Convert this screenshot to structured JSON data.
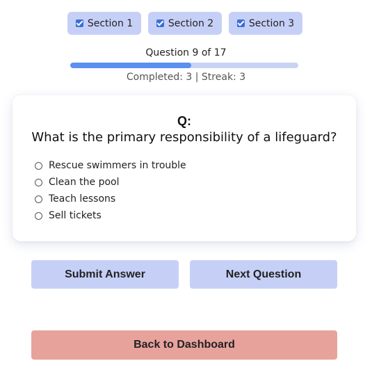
{
  "sections": [
    {
      "label": "Section 1",
      "checked": true
    },
    {
      "label": "Section 2",
      "checked": true
    },
    {
      "label": "Section 3",
      "checked": true
    }
  ],
  "progress": {
    "label": "Question 9 of 17",
    "current": 9,
    "total": 17,
    "fill_fraction": 0.53,
    "stats": "Completed: 3 | Streak: 3"
  },
  "question": {
    "prefix": "Q:",
    "text": "What is the primary responsibility of a lifeguard?",
    "options": [
      "Rescue swimmers in trouble",
      "Clean the pool",
      "Teach lessons",
      "Sell tickets"
    ]
  },
  "buttons": {
    "submit": "Submit Answer",
    "next": "Next Question",
    "back": "Back to Dashboard"
  },
  "colors": {
    "chip_bg": "#c6d0f7",
    "checkbox": "#3b6fd6",
    "progress_fill": "#5b8ff0",
    "progress_track": "#c9d3f4",
    "back_button": "#e8a29c"
  },
  "icons": {
    "section_check": "checkbox-checked-icon",
    "option_radio": "radio-unselected-icon"
  }
}
